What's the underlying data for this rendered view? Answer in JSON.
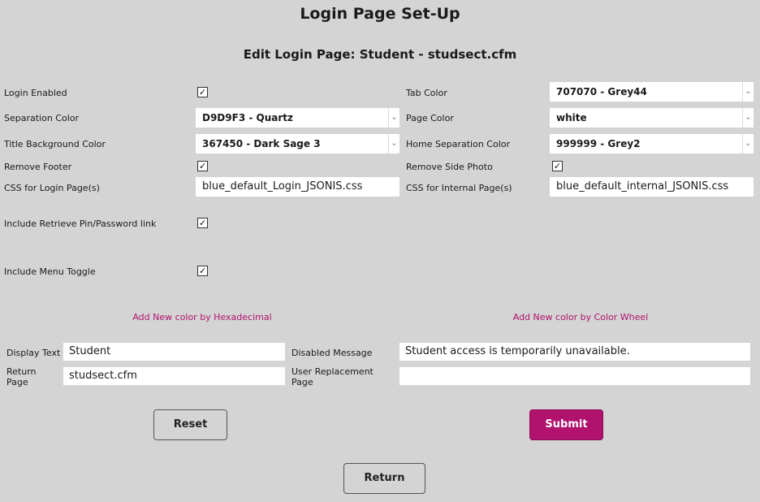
{
  "page": {
    "title": "Login Page Set-Up",
    "subtitle": "Edit Login Page: Student - studsect.cfm"
  },
  "settings": {
    "login_enabled": {
      "label": "Login Enabled",
      "checked": "✓"
    },
    "tab_color": {
      "label": "Tab Color",
      "value": "707070 - Grey44"
    },
    "separation_color": {
      "label": "Separation Color",
      "value": "D9D9F3 - Quartz"
    },
    "page_color": {
      "label": "Page Color",
      "value": "white"
    },
    "title_bg_color": {
      "label": "Title Background Color",
      "value": "367450 - Dark Sage 3"
    },
    "home_separation_color": {
      "label": "Home Separation Color",
      "value": "999999 - Grey2"
    },
    "remove_footer": {
      "label": "Remove Footer",
      "checked": "✓"
    },
    "remove_side_photo": {
      "label": "Remove Side Photo",
      "checked": "✓"
    },
    "css_login": {
      "label": "CSS for Login Page(s)",
      "value": "blue_default_Login_JSONIS.css"
    },
    "css_internal": {
      "label": "CSS for Internal Page(s)",
      "value": "blue_default_internal_JSONIS.css"
    },
    "retrieve_pin": {
      "label": "Include Retrieve Pin/Password link",
      "checked": "✓"
    },
    "menu_toggle": {
      "label": "Include Menu Toggle",
      "checked": "✓"
    }
  },
  "links": {
    "add_hex": "Add New color by Hexadecimal",
    "add_wheel": "Add New color by Color Wheel"
  },
  "form": {
    "display_text": {
      "label": "Display Text",
      "value": "Student"
    },
    "return_page": {
      "label_1": "Return",
      "label_2": "Page",
      "value": "studsect.cfm"
    },
    "disabled_message": {
      "label": "Disabled Message",
      "value": "Student access is temporarily unavailable."
    },
    "user_replacement": {
      "label_1": "User Replacement",
      "label_2": "Page",
      "value": ""
    }
  },
  "buttons": {
    "reset": "Reset",
    "submit": "Submit",
    "return": "Return"
  },
  "icons": {
    "dropdown": "chevron-down-icon",
    "check": "checkmark-icon"
  },
  "colors": {
    "accent": "#b0126e",
    "background": "#d4d4d4"
  }
}
